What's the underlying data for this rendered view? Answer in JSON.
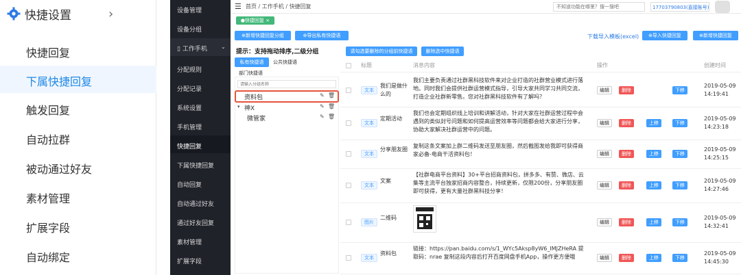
{
  "left_panel": {
    "title": "快捷设置",
    "items": [
      "快捷回复",
      "下属快捷回复",
      "触发回复",
      "自动拉群",
      "被动通过好友",
      "素材管理",
      "扩展字段",
      "自动绑定"
    ]
  },
  "sidebar": {
    "items": [
      "设备管理",
      "设备分组",
      "工作手机",
      "分配规则",
      "分配记录",
      "系统设置",
      "手机管理",
      "快捷回复",
      "下属快捷回复",
      "自动回复",
      "自动通过好友",
      "通过好友回复",
      "素材管理",
      "扩展字段"
    ]
  },
  "topbar": {
    "breadcrumb": [
      "首页",
      "工作手机",
      "快捷回复"
    ],
    "search_placeholder": "不知道功能在哪里？搜一搜吧",
    "user": "17703790803(直接账号)"
  },
  "tab": {
    "label": "快捷回复"
  },
  "actions": {
    "add_group": "新增快捷回复分组",
    "export": "导出私有快捷语",
    "download_template": "下载导入模板(excel)",
    "import": "导入快捷回复",
    "add_reply": "新增快捷回复"
  },
  "group_panel": {
    "hint": "提示：支持拖动排序,二级分组",
    "tabs": [
      "私有快捷语",
      "公共快捷语",
      "部门快捷语"
    ],
    "search_placeholder": "请输入分组名称",
    "groups": [
      "资料包",
      "神X",
      "微管家"
    ]
  },
  "table_actions": {
    "move": "请勾选要删除的分组前快捷语",
    "batch_delete": "删除选中快捷语"
  },
  "table": {
    "headers": [
      "标题",
      "消息内容",
      "操作",
      "创建时间"
    ],
    "btn_edit": "编辑",
    "btn_delete": "删除",
    "btn_up": "上移",
    "btn_down": "下移",
    "rows": [
      {
        "type": "文本",
        "title": "我们是做什么的",
        "content": "我们主要负责通过社群黑科技软件来对企业打造的社群营业模式进行落地。同时我们会提供社群运营模式指导，引导大家共同学习共同交流，打造企业社群新零售。您对社群黑科技软件有了解吗？",
        "date": "2019-05-09",
        "time": "14:19:41"
      },
      {
        "type": "文本",
        "title": "定期活动",
        "content": "我们也会定期组织线上培训和讲解活动，针对大家在社群运营过程中会遇到的类似封号问题和如何提高运营效率等问题都会给大家进行分享，协助大家解决社群运营中的问题。",
        "date": "2019-05-09",
        "time": "14:23:18"
      },
      {
        "type": "文本",
        "title": "分享朋友圈",
        "content": "复制这条文案加上群二维码发送至朋友圈，然后截图发给我即可获得商家必备-电商干活资料包！",
        "date": "2019-05-09",
        "time": "14:25:15"
      },
      {
        "type": "文本",
        "title": "文案",
        "content": "【社群电商平台资料】30+平台招商资料包，拼多多、有赞、微店、云集等主流平台独家招商内容整合，持续更新，仅限200份，分享朋友圈即可获得，更有大量社群黑科技分享！",
        "date": "2019-05-09",
        "time": "14:27:46"
      },
      {
        "type": "图片",
        "title": "二维码",
        "content": "",
        "date": "2019-05-09",
        "time": "14:32:41"
      },
      {
        "type": "文本",
        "title": "资料包",
        "content": "链接：https://pan.baidu.com/s/1_WYc5Aksp8yW6_IMJZHeRA 提取码：nrae 复制这段内容后打开百度网盘手机App，操作更方便哦",
        "date": "2019-05-09",
        "time": "14:45:30"
      }
    ]
  }
}
